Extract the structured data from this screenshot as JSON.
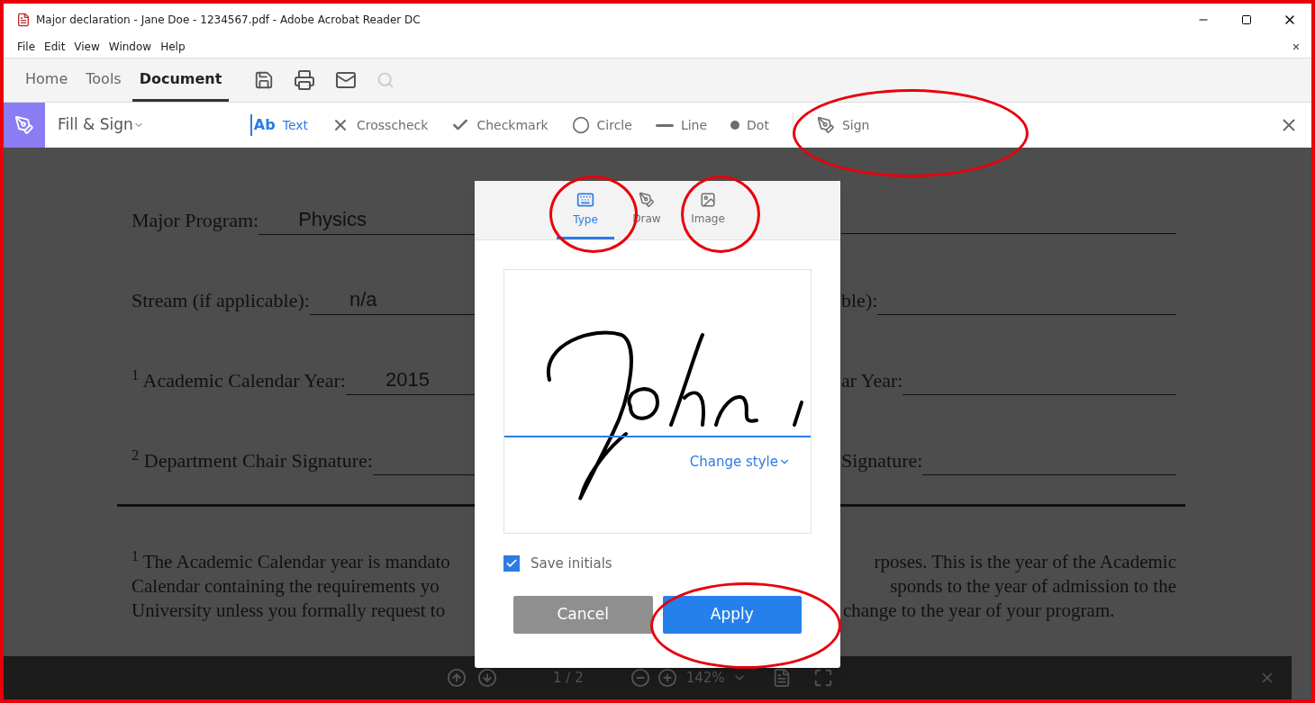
{
  "window": {
    "title": "Major declaration - Jane Doe - 1234567.pdf - Adobe Acrobat Reader DC"
  },
  "menu": [
    "File",
    "Edit",
    "View",
    "Window",
    "Help"
  ],
  "tabs": [
    {
      "label": "Home",
      "selected": false
    },
    {
      "label": "Tools",
      "selected": false
    },
    {
      "label": "Document",
      "selected": true
    }
  ],
  "fill_sign": {
    "title": "Fill & Sign",
    "tools": [
      {
        "kind": "text",
        "glyph": "Ab",
        "label": "Text",
        "selected": true
      },
      {
        "kind": "cross",
        "label": "Crosscheck",
        "selected": false
      },
      {
        "kind": "check",
        "label": "Checkmark",
        "selected": false
      },
      {
        "kind": "circle",
        "label": "Circle",
        "selected": false
      },
      {
        "kind": "line",
        "label": "Line",
        "selected": false
      },
      {
        "kind": "dot",
        "label": "Dot",
        "selected": false
      },
      {
        "kind": "sign",
        "label": "Sign",
        "selected": false
      }
    ]
  },
  "document": {
    "rows": [
      {
        "left_label": "Major Program:",
        "left_value": "Physics",
        "right_label": ""
      },
      {
        "left_label": "Stream (if applicable):",
        "left_value": "n/a",
        "right_label": "ble):"
      },
      {
        "left_label": "$^{1}$ Academic Calendar Year:",
        "left_value": "2015",
        "right_label": "ar Year:"
      },
      {
        "left_label": "$^{2}$ Department Chair Signature:",
        "left_value": "",
        "right_label": "Signature:"
      }
    ],
    "footnote_left": [
      "$^{1}$ The Academic Calendar year is mandato",
      "Calendar containing the requirements yo",
      "University unless you formally request to"
    ],
    "footnote_right": [
      "rposes. This is the year of the Academic",
      "sponds to the year of admission to the",
      "change to the year of your program."
    ]
  },
  "dialog": {
    "tabs": [
      {
        "kind": "type",
        "label": "Type",
        "selected": true
      },
      {
        "kind": "draw",
        "label": "Draw",
        "selected": false
      },
      {
        "kind": "image",
        "label": "Image",
        "selected": false
      }
    ],
    "change_style": "Change style",
    "save_initials": {
      "label": "Save initials",
      "checked": true
    },
    "cancel": "Cancel",
    "apply": "Apply"
  },
  "bottom_bar": {
    "page": "1 / 2",
    "zoom": "142%"
  }
}
